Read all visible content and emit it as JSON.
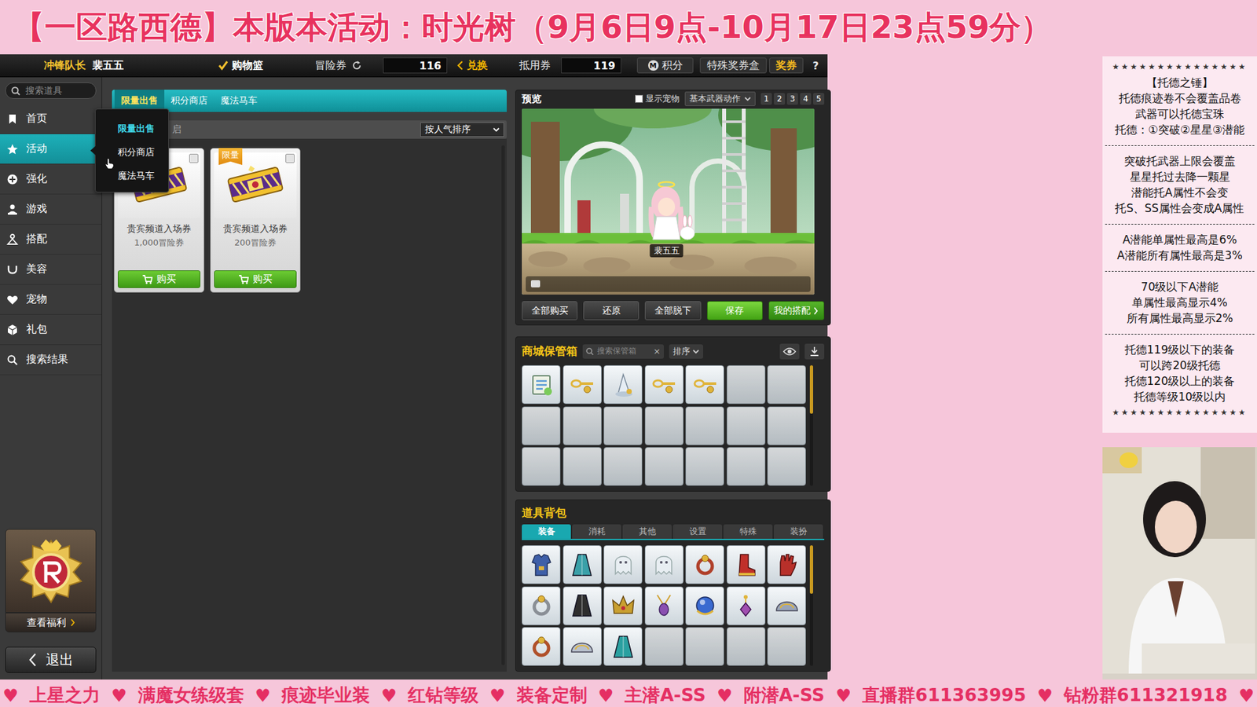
{
  "banner": {
    "title": "【一区路西德】本版本活动：时光树（9月6日9点-10月17日23点59分）"
  },
  "topbar": {
    "rank": "冲锋队长",
    "player": "裴五五",
    "cart": "购物篮",
    "nx_label": "冒险券",
    "nx_value": "116",
    "exchange": "兑换",
    "mp_label": "抵用券",
    "mp_value": "119",
    "points_icon": "M",
    "points": "积分",
    "special_box": "特殊奖券盒",
    "coupon": "奖券",
    "help": "?"
  },
  "sidebar": {
    "search": {
      "placeholder": "搜索道具"
    },
    "items": [
      {
        "label": "首页",
        "selected": false
      },
      {
        "label": "活动",
        "selected": true
      },
      {
        "label": "强化",
        "selected": false
      },
      {
        "label": "游戏",
        "selected": false
      },
      {
        "label": "搭配",
        "selected": false
      },
      {
        "label": "美容",
        "selected": false
      },
      {
        "label": "宠物",
        "selected": false
      },
      {
        "label": "礼包",
        "selected": false
      },
      {
        "label": "搜索结果",
        "selected": false
      }
    ],
    "benefits": "查看福利",
    "exit": "退出"
  },
  "menu": {
    "items": [
      {
        "label": "限量出售",
        "selected": true
      },
      {
        "label": "积分商店",
        "selected": false
      },
      {
        "label": "魔法马车",
        "selected": false
      }
    ]
  },
  "shop": {
    "tabs": [
      {
        "label": "限量出售",
        "selected": true
      },
      {
        "label": "积分商店",
        "selected": false
      },
      {
        "label": "魔法马车",
        "selected": false
      }
    ],
    "filter_text": "启",
    "sort": "按人气排序",
    "cards": [
      {
        "name": "贵宾频道入场券",
        "price": "1,000冒险券",
        "button": "购买",
        "badge": null
      },
      {
        "name": "贵宾频道入场券",
        "price": "200冒险券",
        "button": "购买",
        "badge": "限量"
      }
    ]
  },
  "preview": {
    "title": "预览",
    "show_pet": {
      "label": "显示宠物",
      "checked": false
    },
    "action": "基本武器动作",
    "pages": [
      {
        "label": "1",
        "selected": false
      },
      {
        "label": "2",
        "selected": false
      },
      {
        "label": "3",
        "selected": false
      },
      {
        "label": "4",
        "selected": false
      },
      {
        "label": "5",
        "selected": false
      }
    ],
    "character": "裴五五",
    "buttons": [
      {
        "label": "全部购买",
        "kind": "normal"
      },
      {
        "label": "还原",
        "kind": "normal"
      },
      {
        "label": "全部脱下",
        "kind": "normal"
      },
      {
        "label": "保存",
        "kind": "primary"
      },
      {
        "label": "我的搭配",
        "kind": "link"
      }
    ]
  },
  "storage": {
    "title": "商城保管箱",
    "search": {
      "placeholder": "搜索保管箱",
      "clear": "×"
    },
    "sort": "排序",
    "slots": [
      {
        "kind": "item"
      },
      {
        "kind": "item"
      },
      {
        "kind": "item"
      },
      {
        "kind": "item"
      },
      {
        "kind": "item"
      },
      {
        "kind": "empty"
      },
      {
        "kind": "empty"
      },
      {
        "kind": "empty"
      },
      {
        "kind": "empty"
      },
      {
        "kind": "empty"
      },
      {
        "kind": "empty"
      },
      {
        "kind": "empty"
      },
      {
        "kind": "empty"
      },
      {
        "kind": "empty"
      },
      {
        "kind": "empty"
      },
      {
        "kind": "empty"
      },
      {
        "kind": "empty"
      },
      {
        "kind": "empty"
      },
      {
        "kind": "empty"
      },
      {
        "kind": "empty"
      },
      {
        "kind": "empty"
      }
    ]
  },
  "bag": {
    "title": "道具背包",
    "tabs": [
      {
        "label": "装备",
        "selected": true
      },
      {
        "label": "消耗",
        "selected": false
      },
      {
        "label": "其他",
        "selected": false
      },
      {
        "label": "设置",
        "selected": false
      },
      {
        "label": "特殊",
        "selected": false
      },
      {
        "label": "装扮",
        "selected": false
      }
    ],
    "slots": [
      {
        "kind": "item"
      },
      {
        "kind": "item"
      },
      {
        "kind": "item"
      },
      {
        "kind": "item"
      },
      {
        "kind": "item"
      },
      {
        "kind": "item"
      },
      {
        "kind": "item"
      },
      {
        "kind": "item"
      },
      {
        "kind": "item"
      },
      {
        "kind": "item"
      },
      {
        "kind": "item"
      },
      {
        "kind": "item"
      },
      {
        "kind": "item"
      },
      {
        "kind": "item"
      },
      {
        "kind": "item"
      },
      {
        "kind": "item"
      },
      {
        "kind": "item"
      },
      {
        "kind": "empty"
      },
      {
        "kind": "empty"
      },
      {
        "kind": "empty"
      },
      {
        "kind": "empty"
      }
    ]
  },
  "notes": {
    "lines": [
      {
        "kind": "stars",
        "text": "★★★★★★★★★★★★★★★"
      },
      {
        "kind": "text",
        "text": "【托德之锤】"
      },
      {
        "kind": "text",
        "text": "托德痕迹卷不会覆盖品卷"
      },
      {
        "kind": "text",
        "text": "武器可以托德宝珠"
      },
      {
        "kind": "text",
        "text": "托德：①突破②星星③潜能"
      },
      {
        "kind": "divider",
        "text": ""
      },
      {
        "kind": "text",
        "text": "突破托武器上限会覆盖"
      },
      {
        "kind": "text",
        "text": "星星托过去降一颗星"
      },
      {
        "kind": "text",
        "text": "潜能托A属性不会变"
      },
      {
        "kind": "text",
        "text": "托S、SS属性会变成A属性"
      },
      {
        "kind": "divider",
        "text": ""
      },
      {
        "kind": "text",
        "text": "A潜能单属性最高是6%"
      },
      {
        "kind": "text",
        "text": "A潜能所有属性最高是3%"
      },
      {
        "kind": "divider",
        "text": ""
      },
      {
        "kind": "text",
        "text": "70级以下A潜能"
      },
      {
        "kind": "text",
        "text": "单属性最高显示4%"
      },
      {
        "kind": "text",
        "text": "所有属性最高显示2%"
      },
      {
        "kind": "divider",
        "text": ""
      },
      {
        "kind": "text",
        "text": "托德119级以下的装备"
      },
      {
        "kind": "text",
        "text": "可以跨20级托德"
      },
      {
        "kind": "text",
        "text": "托德120级以上的装备"
      },
      {
        "kind": "text",
        "text": "托德等级10级以内"
      },
      {
        "kind": "stars",
        "text": "★★★★★★★★★★★★★★★"
      }
    ]
  },
  "ticker": {
    "separator": "♥",
    "items": [
      "上星之力",
      "满魔女练级套",
      "痕迹毕业装",
      "红钻等级",
      "装备定制",
      "主潜A-SS",
      "附潜A-SS",
      "直播群611363995",
      "钻粉群611321918"
    ]
  }
}
